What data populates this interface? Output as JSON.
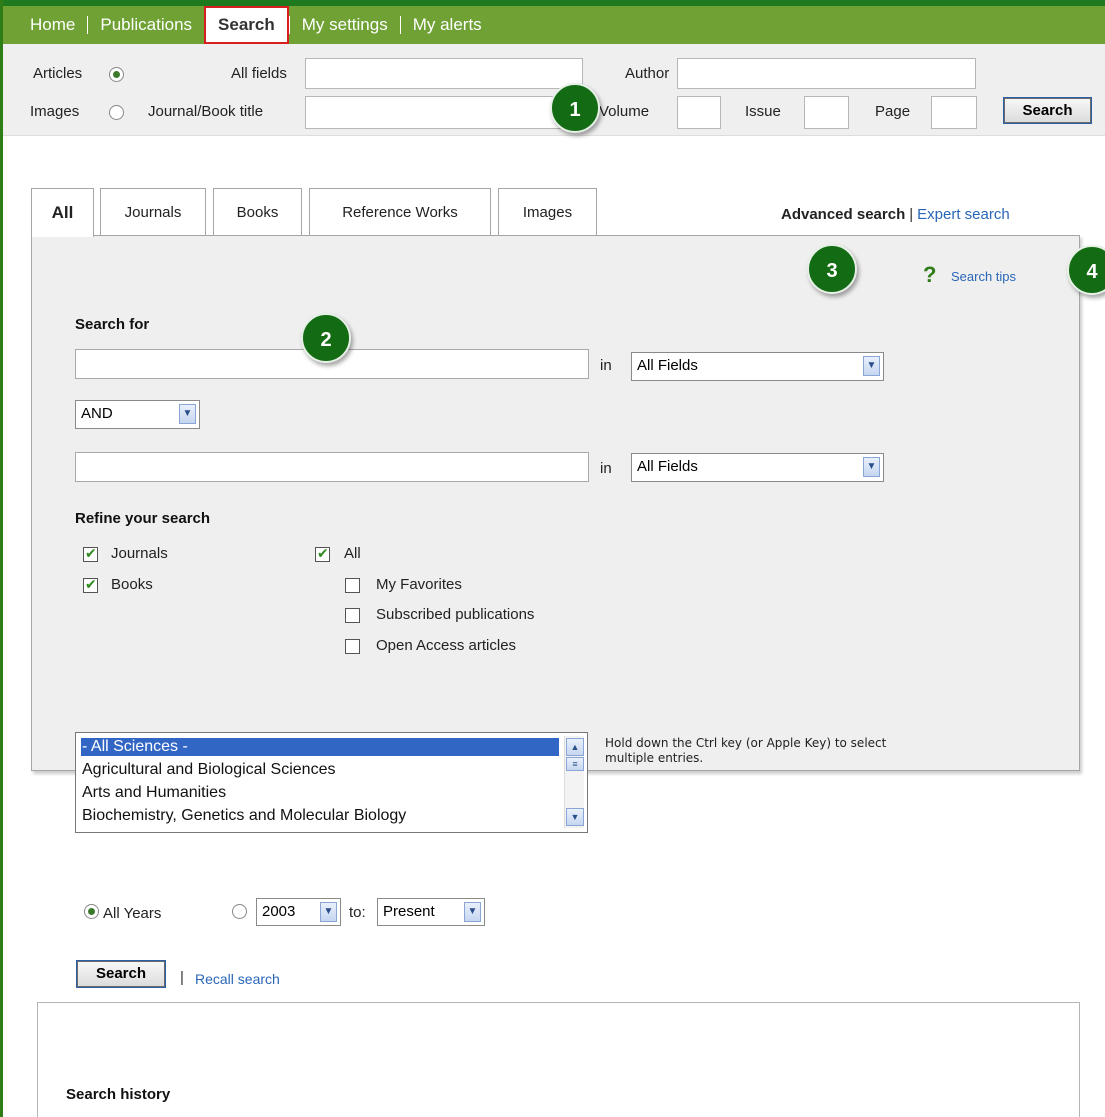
{
  "nav": {
    "items": [
      "Home",
      "Publications",
      "Search",
      "My settings",
      "My alerts"
    ]
  },
  "quick_search": {
    "articles_label": "Articles",
    "images_label": "Images",
    "all_fields_label": "All fields",
    "journal_title_label": "Journal/Book title",
    "author_label": "Author",
    "volume_label": "Volume",
    "issue_label": "Issue",
    "page_label": "Page",
    "search_button": "Search",
    "selected_scope": "Articles"
  },
  "callouts": [
    "1",
    "2",
    "3",
    "4"
  ],
  "tabs": [
    "All",
    "Journals",
    "Books",
    "Reference Works",
    "Images"
  ],
  "active_tab": "All",
  "search_modes": {
    "advanced": "Advanced search",
    "separator": "|",
    "expert": "Expert search"
  },
  "search_tips": "Search tips",
  "form": {
    "search_for_label": "Search for",
    "in_label": "in",
    "field1_select": "All Fields",
    "operator": "AND",
    "field2_select": "All Fields",
    "refine_label": "Refine your search",
    "checkboxes": {
      "journals": {
        "label": "Journals",
        "checked": true
      },
      "books": {
        "label": "Books",
        "checked": true
      },
      "all": {
        "label": "All",
        "checked": true
      },
      "favorites": {
        "label": "My Favorites",
        "checked": false
      },
      "subscribed": {
        "label": "Subscribed publications",
        "checked": false
      },
      "open_access": {
        "label": "Open Access articles",
        "checked": false
      }
    },
    "subjects": [
      "- All Sciences -",
      "Agricultural and Biological Sciences",
      "Arts and Humanities",
      "Biochemistry, Genetics and Molecular Biology"
    ],
    "subject_hint": "Hold down the Ctrl key (or Apple Key) to select multiple entries.",
    "all_years_label": "All Years",
    "year_from": "2003",
    "to_label": "to:",
    "year_to": "Present",
    "search_button": "Search",
    "pipe": "|",
    "recall_search": "Recall search"
  },
  "history": {
    "title": "Search history"
  },
  "colors": {
    "nav_green": "#6fa135",
    "badge_green": "#136b13",
    "link_blue": "#2a66b8",
    "active_outline": "#d81e1e"
  }
}
